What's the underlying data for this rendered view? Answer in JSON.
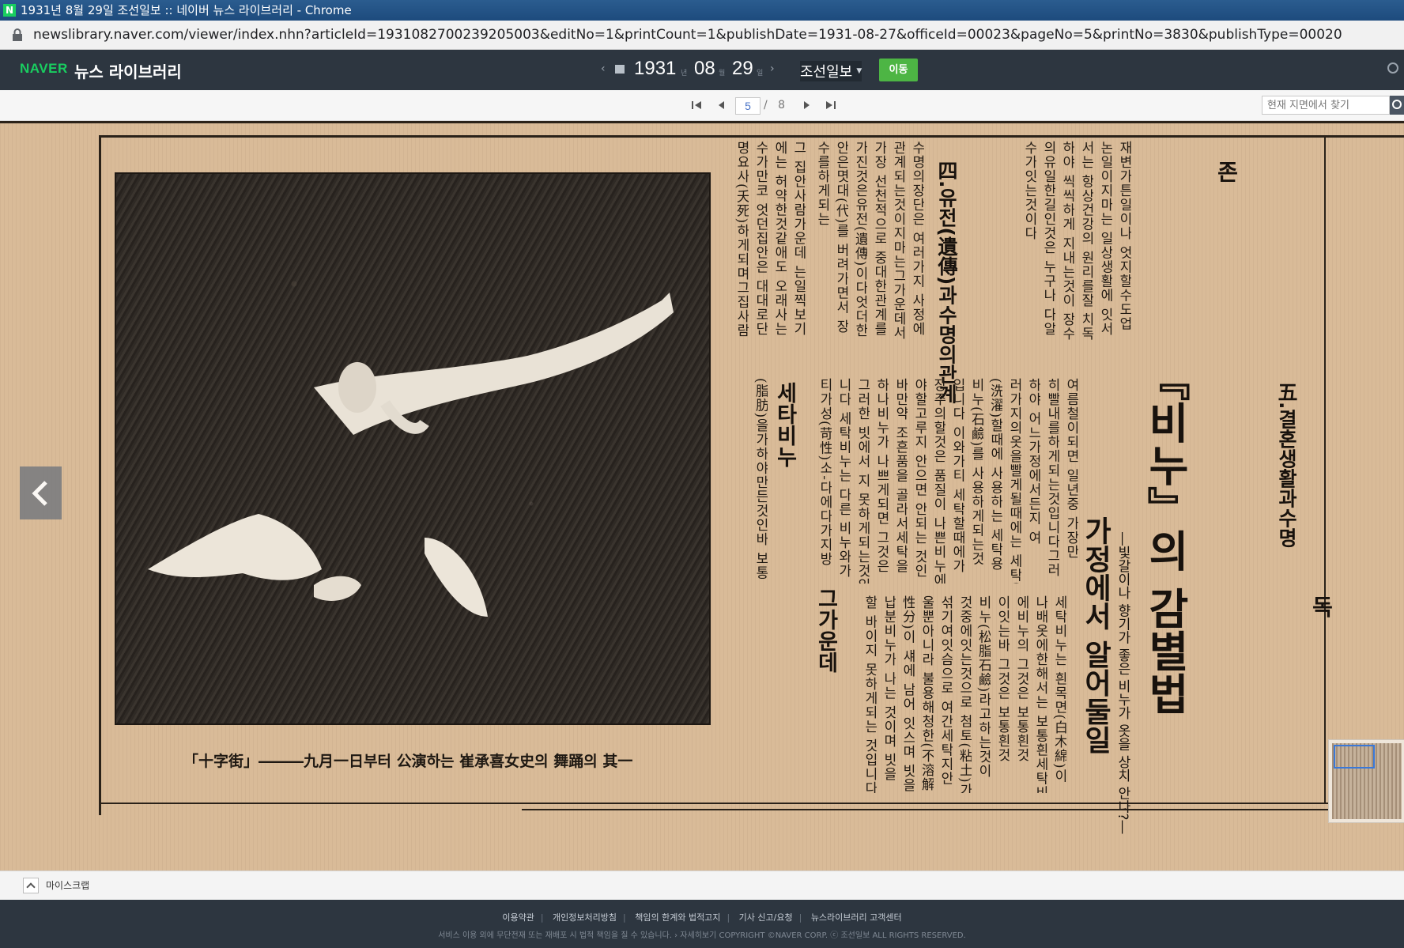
{
  "window": {
    "title": "1931년 8월 29일 조선일보 :: 네이버 뉴스 라이브러리 - Chrome",
    "favicon": "N"
  },
  "address": {
    "url": "newslibrary.naver.com/viewer/index.nhn?articleId=1931082700239205003&editNo=1&printCount=1&publishDate=1931-08-27&officeId=00023&pageNo=5&printNo=3830&publishType=00020"
  },
  "header": {
    "logo_naver": "NAVER",
    "logo_library": "뉴스 라이브러리",
    "date": {
      "year": "1931",
      "year_unit": "년",
      "month": "08",
      "month_unit": "월",
      "day": "29",
      "day_unit": "일"
    },
    "newspaper": "조선일보",
    "go_label": "이동"
  },
  "pager": {
    "current": "5",
    "separator": "/",
    "total": "8",
    "search_placeholder": "현재 지면에서 찾기"
  },
  "article": {
    "headline": "『비누』의 감별법",
    "subheadline": "가정에서 알어둘일",
    "deck": "―빛갈이나 향기가 좋은 비누가 옷을 상치 안나?―",
    "section_heads": [
      "四.유전(遺傳)과수명의관계",
      "존",
      "五.결혼생활과수명",
      "독",
      "세타비누",
      "그가운데"
    ],
    "caption": "「十字街」―――九月一日부터 公演하는 崔承喜女史의 舞踊의 其一",
    "columns": [
      "수명의장단은 여러가지 사정에",
      "관계되는것이지마는그가운데서",
      "가장 선천적으로 중대한관계를",
      "가진것은유전(遺傳)이다엇더한",
      "안은몃대(代)를 버려가면서 장",
      "수를하게되는",
      "그 집안사람가운데 는일찍보기",
      "에는 허약한것같애도 오래사는",
      "수가만코 엇던집안은 대대로단",
      "명요사(夭死)하게되며그집사람",
      "재변가튼일이나 엇지할수도업",
      "논일이지마는 일상생활에 잇서",
      "서는 항상건강의 원리를잘 치독",
      "하야 씩씩하게 지내는것이 장수",
      "의유일한길인것은 누구나 다알",
      "수가잇는것이다",
      "여름철이되면 일년중 가장만",
      "히빨내를하게되는것입니다그러",
      "하야 어느가정에서든지 여",
      "러가지의옷을빨게될때에는 세탁용",
      "(洗濯)할때에 사용하는 세탁용",
      "비누(石鹼)를 사용하게되는것",
      "입니다 이와가티 세탁할때에가",
      "장주의할것은 품질이 나쁜비누에",
      "야할고루지 안으면 안되는 것인",
      "바만약 조흔품을 골라서세탁을",
      "하나비누가 나쁘게되면 그것은",
      "그러한 빗에서 지 못하게되는것입",
      "니다 세탁비누는 다른 비누와가",
      "티가성(苛性)소-다에다가지방",
      "(脂肪)을가하야만든것인바 보통",
      "세탁비누는 흰목면(白木綿)이",
      "나배옷에한해서는 보통흰세탁비누",
      "에비누의 그것은 보통흰것",
      "이잇는바 그것은 보통흰것",
      "비누(松脂石鹼)라고하는것이",
      "것중에잇는것으로 첨토(粘土)가",
      "섞기여잇슴으로 여간세탁지안",
      "울뿐아니라 불용해청한(不溶解",
      "性分)이 섀에 남어 잇스며 빗을",
      "납분비누가 나는 것이며 빗을",
      "할 바이지 못하게되는 것입니다"
    ]
  },
  "myscrap": {
    "label": "마이스크랩"
  },
  "footer": {
    "links": [
      "이용약관",
      "개인정보처리방침",
      "책임의 한계와 법적고지",
      "기사 신고/요청",
      "뉴스라이브러리 고객센터"
    ],
    "notice": "서비스 이용 외에 무단전재 또는 재배포 시 법적 책임을 질 수 있습니다.  › 자세히보기      COPYRIGHT ©NAVER CORP. ⓒ 조선일보 ALL RIGHTS RESERVED."
  }
}
